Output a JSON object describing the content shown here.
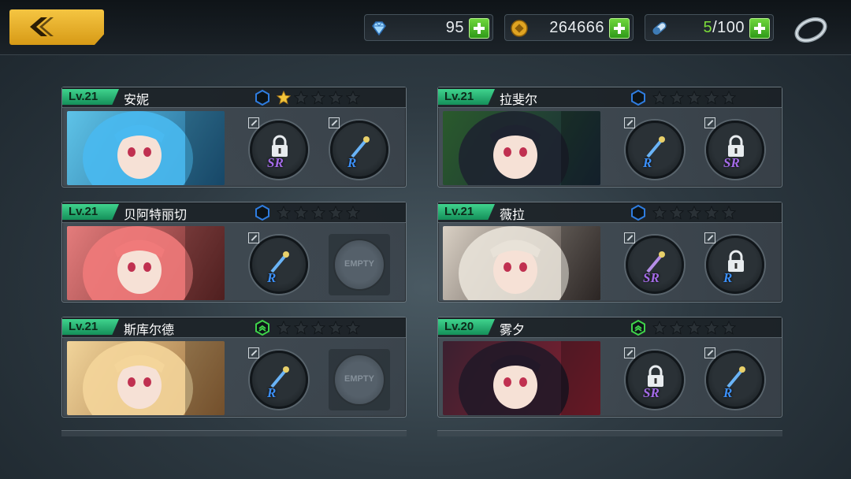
{
  "back": {
    "icon": "chevron-left-icon"
  },
  "resources": [
    {
      "name": "diamonds",
      "icon": "gem-icon",
      "value": "95"
    },
    {
      "name": "gold",
      "icon": "coin-icon",
      "value": "264666"
    },
    {
      "name": "stamina",
      "icon": "capsule-icon",
      "value_current": "5",
      "value_max": "/100"
    }
  ],
  "characters": [
    {
      "level": "Lv.21",
      "name": "安妮",
      "grade": "blue",
      "stars_filled": 1,
      "slots": [
        {
          "type": "item",
          "rarity": "SR",
          "locked": true
        },
        {
          "type": "item",
          "rarity": "R",
          "locked": false
        }
      ]
    },
    {
      "level": "Lv.21",
      "name": "拉斐尔",
      "grade": "blue",
      "stars_filled": 0,
      "slots": [
        {
          "type": "item",
          "rarity": "R",
          "locked": false
        },
        {
          "type": "item",
          "rarity": "SR",
          "locked": true
        }
      ]
    },
    {
      "level": "Lv.21",
      "name": "贝阿特丽切",
      "grade": "blue",
      "stars_filled": 0,
      "slots": [
        {
          "type": "item",
          "rarity": "R",
          "locked": false
        },
        {
          "type": "empty",
          "label": "EMPTY"
        }
      ]
    },
    {
      "level": "Lv.21",
      "name": "薇拉",
      "grade": "blue",
      "stars_filled": 0,
      "slots": [
        {
          "type": "item",
          "rarity": "SR",
          "locked": false
        },
        {
          "type": "item",
          "rarity": "R",
          "locked": true
        }
      ]
    },
    {
      "level": "Lv.21",
      "name": "斯库尔德",
      "grade": "green",
      "stars_filled": 0,
      "slots": [
        {
          "type": "item",
          "rarity": "R",
          "locked": false
        },
        {
          "type": "empty",
          "label": "EMPTY"
        }
      ]
    },
    {
      "level": "Lv.20",
      "name": "雾夕",
      "grade": "green",
      "stars_filled": 0,
      "slots": [
        {
          "type": "item",
          "rarity": "SR",
          "locked": true
        },
        {
          "type": "item",
          "rarity": "R",
          "locked": false
        }
      ]
    }
  ],
  "colors": {
    "accent_gold": "#e0a422",
    "level_green": "#2fbf78",
    "sr_purple": "#a46be8",
    "r_blue": "#3b8ff7",
    "grade_blue": "#2f7de0",
    "grade_green": "#3fd34a"
  }
}
